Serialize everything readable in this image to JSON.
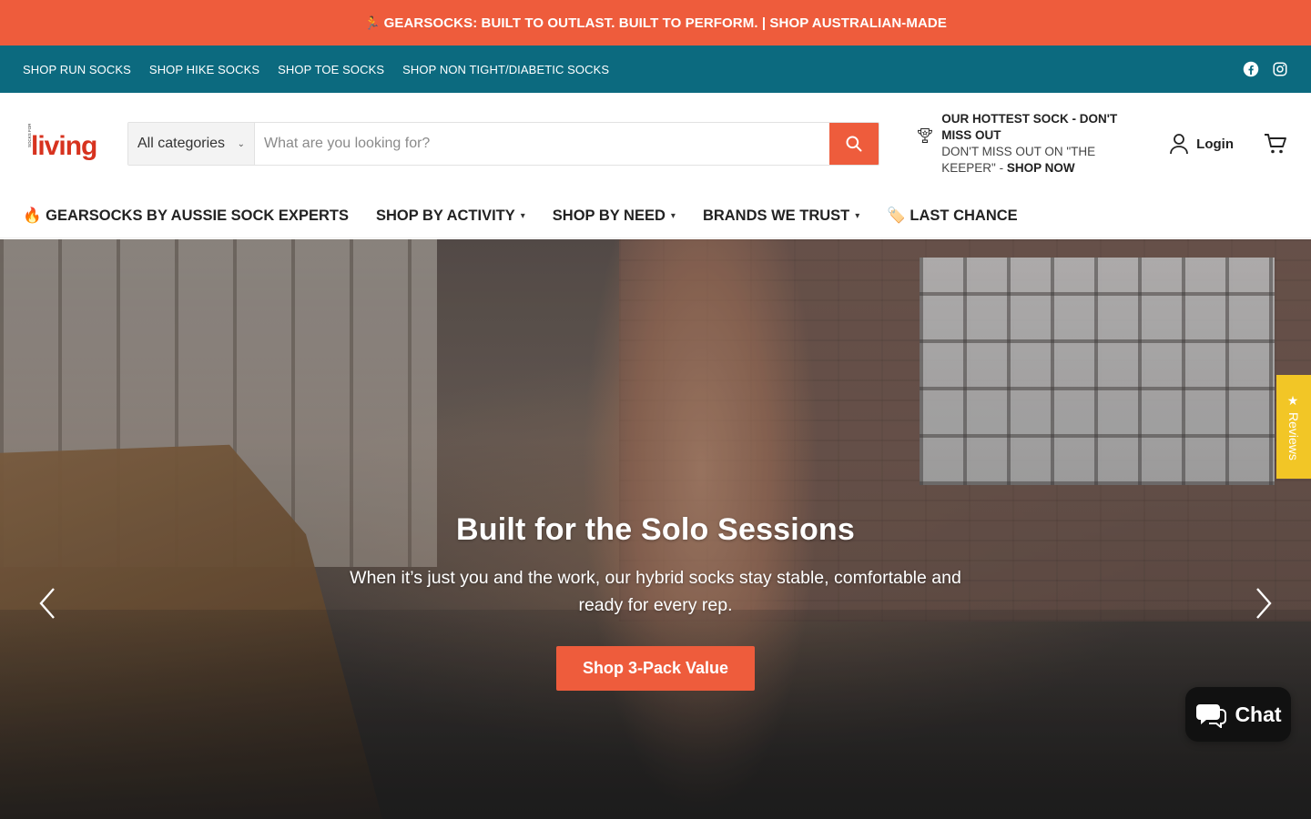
{
  "announcement": {
    "icon": "runner-icon",
    "text": "GEARSOCKS: BUILT TO OUTLAST. BUILT TO PERFORM. | SHOP AUSTRALIAN-MADE"
  },
  "topnav": {
    "links": [
      "SHOP RUN SOCKS",
      "SHOP HIKE SOCKS",
      "SHOP TOE SOCKS",
      "SHOP NON TIGHT/DIABETIC SOCKS"
    ],
    "social": [
      "facebook-icon",
      "instagram-icon"
    ]
  },
  "header": {
    "logo": {
      "text": "living",
      "small_text": "SOCKS FOR"
    },
    "search": {
      "category": "All categories",
      "placeholder": "What are you looking for?"
    },
    "promo": {
      "title": "OUR HOTTEST SOCK - DON'T MISS OUT",
      "subtitle": "DON'T MISS OUT ON \"THE KEEPER\" - ",
      "cta": "SHOP NOW"
    },
    "login": "Login"
  },
  "mainnav": {
    "items": [
      {
        "label": "🔥 GEARSOCKS BY AUSSIE SOCK EXPERTS",
        "dropdown": false
      },
      {
        "label": "SHOP BY ACTIVITY",
        "dropdown": true
      },
      {
        "label": "SHOP BY NEED",
        "dropdown": true
      },
      {
        "label": "BRANDS WE TRUST",
        "dropdown": true
      },
      {
        "label": "🏷️ LAST CHANCE",
        "dropdown": false
      }
    ]
  },
  "hero": {
    "title": "Built for the Solo Sessions",
    "text": "When it’s just you and the work, our hybrid socks stay stable, comfortable and ready for every rep.",
    "button": "Shop 3-Pack Value"
  },
  "reviews_tab": {
    "label": "Reviews"
  },
  "chat": {
    "label": "Chat"
  },
  "colors": {
    "accent": "#ee5c3c",
    "topnav": "#0c6a7f",
    "reviews": "#f2c626"
  }
}
